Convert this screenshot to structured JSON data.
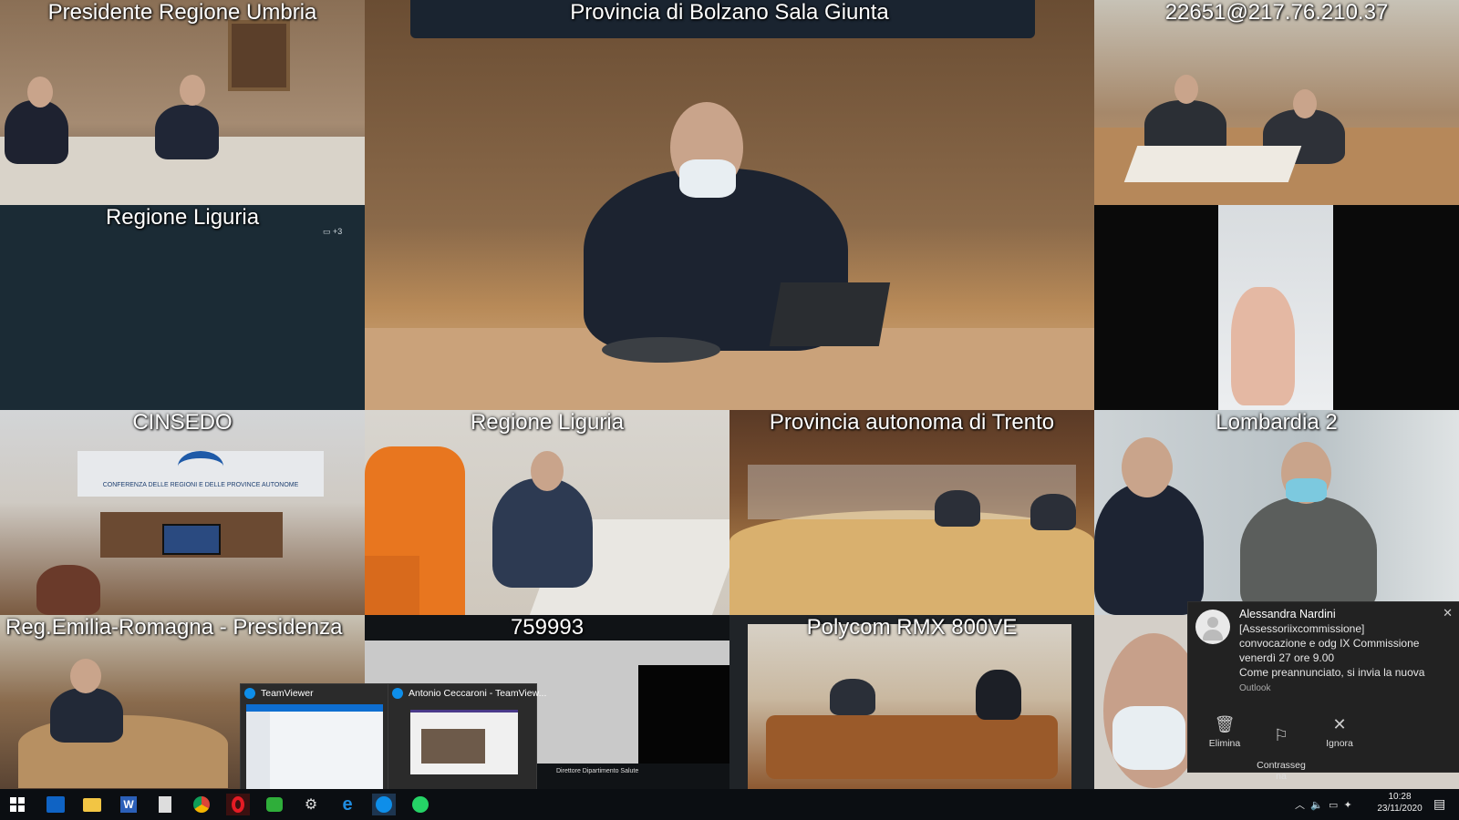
{
  "tiles": {
    "umbria": "Presidente Regione Umbria",
    "bolzano": "Provincia di Bolzano Sala Giunta",
    "ip": "22651@217.76.210.37",
    "liguria_top": "Regione Liguria",
    "liguria_top_count": "+3",
    "cinsedo": "CINSEDO",
    "cinsedo_banner": "CONFERENZA DELLE REGIONI E DELLE PROVINCE AUTONOME",
    "liguria": "Regione Liguria",
    "trento": "Provincia autonoma di Trento",
    "lombardia": "Lombardia 2",
    "emilia": "Reg.Emilia-Romagna - Presidenza",
    "num": "759993",
    "polycom": "Polycom RMX 800VE",
    "direttore": "Direttore Dipartimento Salute"
  },
  "teamviewer": {
    "title1": "TeamViewer",
    "title2": "Antonio Ceccaroni - TeamView..."
  },
  "toast": {
    "sender": "Alessandra Nardini",
    "line1": "[Assessoriixcommissione]",
    "line2": "convocazione e odg IX Commissione",
    "line3": "venerdì 27 ore 9.00",
    "line4": "Come preannunciato,  si invia la nuova",
    "app": "Outlook",
    "action_delete": "Elimina",
    "action_flag": "Contrasseg\nna",
    "action_ignore": "Ignora"
  },
  "clock": {
    "time": "10:28",
    "date": "23/11/2020"
  },
  "icons": [
    "windows-start-icon",
    "outlook-icon",
    "file-explorer-icon",
    "word-icon",
    "calculator-icon",
    "chrome-icon",
    "opera-icon",
    "green-app-icon",
    "settings-icon",
    "edge-icon",
    "teamviewer-icon",
    "whatsapp-icon"
  ]
}
